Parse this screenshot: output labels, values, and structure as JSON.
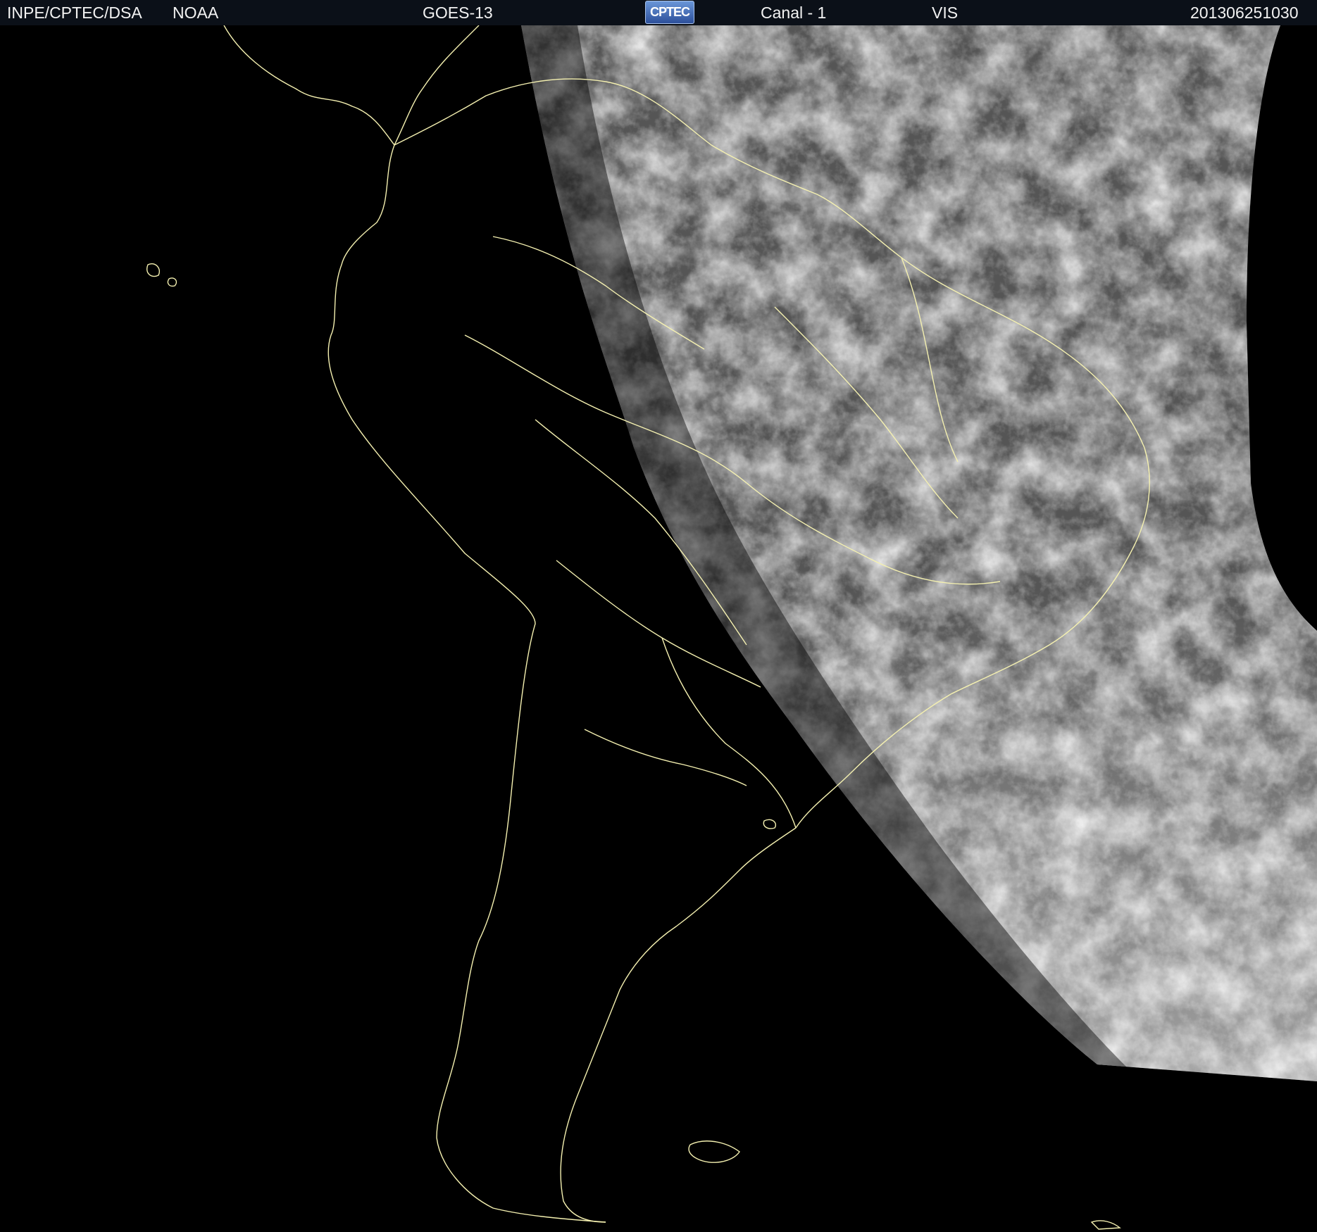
{
  "header": {
    "institution": "INPE/CPTEC/DSA",
    "agency": "NOAA",
    "satellite": "GOES-13",
    "logo_text": "CPTEC",
    "channel": "Canal - 1",
    "band": "VIS",
    "timestamp": "201306251030"
  },
  "colors": {
    "header_bg": "#0b1018",
    "coastline": "#f4f0b0",
    "space": "#000000"
  }
}
